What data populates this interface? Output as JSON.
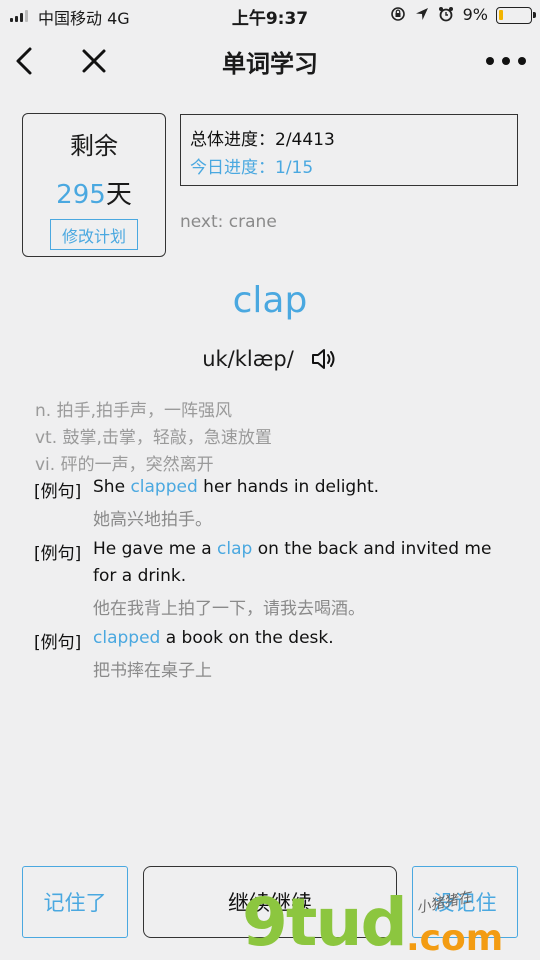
{
  "status_bar": {
    "carrier": "中国移动  4G",
    "time": "上午9:37",
    "battery": "9%",
    "battery_level": 0.09,
    "icons": [
      "lock-rotation-icon",
      "location-arrow-icon",
      "alarm-icon"
    ]
  },
  "nav": {
    "title": "单词学习",
    "back_icon": "chevron-left-icon",
    "close_icon": "close-icon",
    "more_icon": "more-dots-icon"
  },
  "plan": {
    "remaining_label": "剩余",
    "remaining_days": "295",
    "days_unit": "天",
    "modify_label": "修改计划"
  },
  "progress": {
    "total": "总体进度：2/4413",
    "today": "今日进度：1/15",
    "next": "next: crane"
  },
  "word": {
    "headword": "clap",
    "phonetic": "uk/klæp/",
    "speaker_icon": "speaker-icon"
  },
  "definitions": [
    "n. 拍手,拍手声，一阵强风",
    "vt. 鼓掌,击掌，轻敲，急速放置",
    "vi. 砰的一声，突然离开"
  ],
  "examples": [
    {
      "tag": "[例句]",
      "en_before": "She ",
      "en_highlight": "clapped",
      "en_after": " her hands in delight.",
      "zh": "她高兴地拍手。"
    },
    {
      "tag": "[例句]",
      "en_before": "He gave me a ",
      "en_highlight": "clap",
      "en_after": " on the back and invited me for a drink.",
      "zh": "他在我背上拍了一下，请我去喝酒。"
    },
    {
      "tag": "[例句]",
      "en_before": "",
      "en_highlight": "clapped",
      "en_after": " a book on the desk.",
      "zh": "把书摔在桌子上"
    }
  ],
  "buttons": {
    "remembered": "记住了",
    "continue": "继续继续",
    "not_remembered": "没记住"
  },
  "watermark": {
    "brand": "9tud",
    "suffix": ".com",
    "small": "小猪猪在"
  },
  "colors": {
    "accent": "#4aa8e0",
    "background": "#efeff0",
    "battery_low": "#f2b400"
  }
}
